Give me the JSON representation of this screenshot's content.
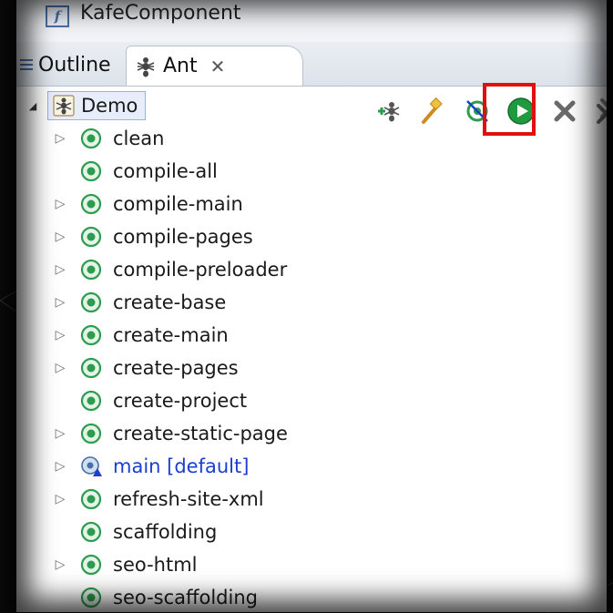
{
  "editor": {
    "file_icon_letter": "f",
    "title": "KafeComponent"
  },
  "tabs": {
    "outline_label": "Outline",
    "ant_label": "Ant",
    "ant_close": "✕"
  },
  "toolbar": {
    "add_buildfile_icon": "add-buildfile-icon",
    "search_icon": "search-buildfile-icon",
    "hide_internal_icon": "hide-internal-targets-icon",
    "run_icon": "run-icon",
    "remove_icon": "remove-icon",
    "remove_all_icon": "remove-all-icon",
    "highlight_color": "#e01010"
  },
  "tree": {
    "root": {
      "expander": "◢",
      "label": "Demo"
    },
    "targets": [
      {
        "label": "clean",
        "expandable": true
      },
      {
        "label": "compile-all",
        "expandable": false
      },
      {
        "label": "compile-main",
        "expandable": true
      },
      {
        "label": "compile-pages",
        "expandable": true
      },
      {
        "label": "compile-preloader",
        "expandable": true
      },
      {
        "label": "create-base",
        "expandable": true
      },
      {
        "label": "create-main",
        "expandable": true
      },
      {
        "label": "create-pages",
        "expandable": true
      },
      {
        "label": "create-project",
        "expandable": false
      },
      {
        "label": "create-static-page",
        "expandable": true
      },
      {
        "label": "main [default]",
        "expandable": true,
        "is_default": true
      },
      {
        "label": "refresh-site-xml",
        "expandable": true
      },
      {
        "label": "scaffolding",
        "expandable": false
      },
      {
        "label": "seo-html",
        "expandable": true
      },
      {
        "label": "seo-scaffolding",
        "expandable": false
      }
    ],
    "twisty_char": "▷"
  },
  "colors": {
    "target_green": "#2e9b4e",
    "default_blue": "#1a3fd0",
    "run_green": "#1f9a3e"
  }
}
